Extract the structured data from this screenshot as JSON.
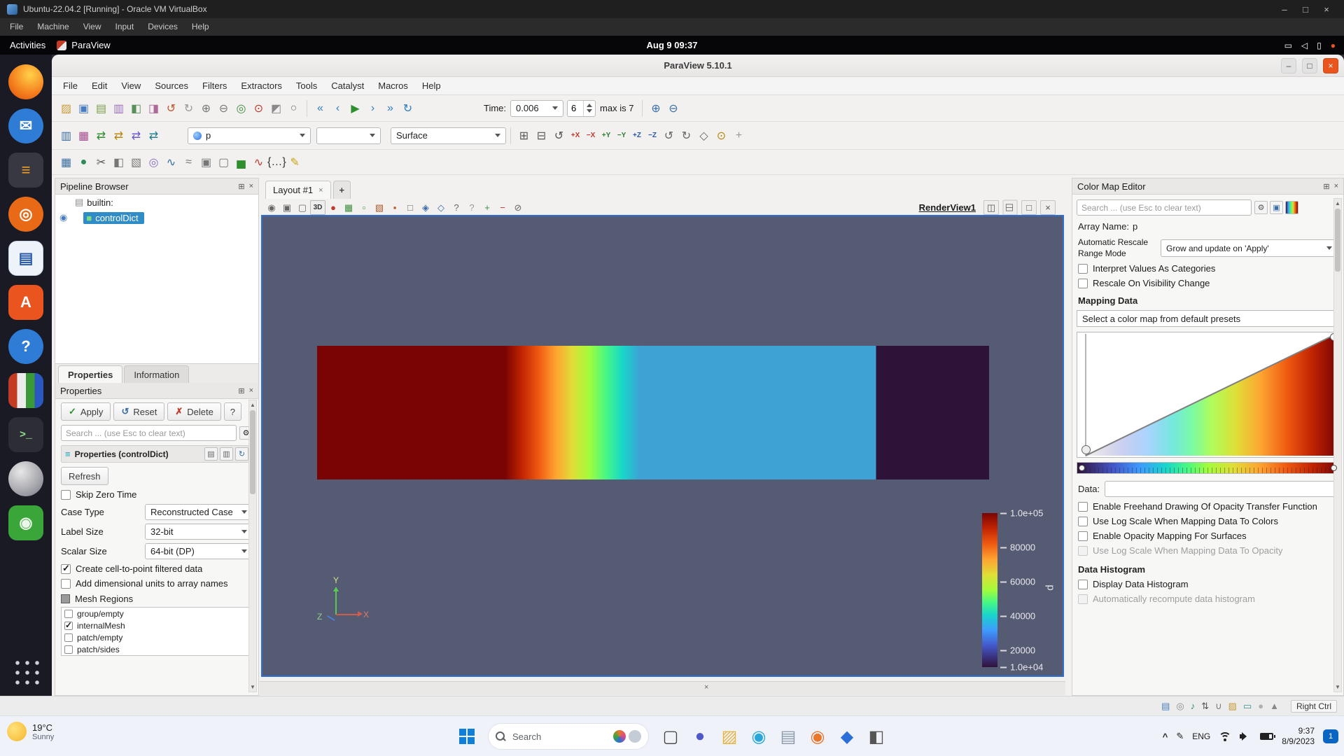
{
  "colors": {
    "selection": "#308cc6",
    "viewport_background": "#565b74",
    "accent_close": "#e9541f",
    "colormap_turbo": [
      "#30123b",
      "#4458cb",
      "#3e9bfe",
      "#18d6cb",
      "#46f884",
      "#a2fc3c",
      "#e1dd37",
      "#fea331",
      "#ef5a11",
      "#c22402",
      "#7a0403"
    ]
  },
  "vbox": {
    "title": "Ubuntu-22.04.2 [Running] - Oracle VM VirtualBox",
    "menu": [
      {
        "n": "vbox-menu-file",
        "label": "File"
      },
      {
        "n": "vbox-menu-machine",
        "label": "Machine"
      },
      {
        "n": "vbox-menu-view",
        "label": "View"
      },
      {
        "n": "vbox-menu-input",
        "label": "Input"
      },
      {
        "n": "vbox-menu-devices",
        "label": "Devices"
      },
      {
        "n": "vbox-menu-help",
        "label": "Help"
      }
    ],
    "window_buttons": {
      "min": "–",
      "max": "□",
      "close": "×"
    },
    "status_icons": [
      {
        "n": "hdd-status-icon",
        "g": "▤",
        "c": "#4a7dbf"
      },
      {
        "n": "optical-status-icon",
        "g": "◎",
        "c": "#8a8a8a"
      },
      {
        "n": "audio-status-icon",
        "g": "♪",
        "c": "#2e8b57"
      },
      {
        "n": "network-status-icon",
        "g": "⇅",
        "c": "#555555"
      },
      {
        "n": "usb-status-icon",
        "g": "∪",
        "c": "#777777"
      },
      {
        "n": "shared-folders-status-icon",
        "g": "▨",
        "c": "#c99c3a"
      },
      {
        "n": "display-status-icon",
        "g": "▭",
        "c": "#3f8f8f"
      },
      {
        "n": "recording-status-icon",
        "g": "●",
        "c": "#b0b0b0"
      },
      {
        "n": "mouse-status-icon",
        "g": "▲",
        "c": "#888888"
      }
    ],
    "host_key": "Right Ctrl"
  },
  "ubuntu": {
    "activities": "Activities",
    "app": "ParaView",
    "clock": "Aug 9  09:37",
    "tray": [
      {
        "n": "screencast-icon",
        "g": "▭",
        "c": "#ffffff"
      },
      {
        "n": "volume-tray-icon",
        "g": "◁",
        "c": "#ffffff"
      },
      {
        "n": "battery-tray-icon",
        "g": "▯",
        "c": "#ffffff"
      },
      {
        "n": "notification-dot-icon",
        "g": "●",
        "c": "#e95420"
      }
    ]
  },
  "dock": {
    "items": [
      {
        "n": "firefox-dock-icon",
        "g": "",
        "bg": "radial-gradient(circle at 62% 30%, #ffd24a, #f5821f 55%, #e3560f 90%)",
        "cls": "round"
      },
      {
        "n": "thunderbird-dock-icon",
        "g": "✉",
        "c": "#ffffff",
        "bg": "#2e7cd6",
        "cls": "round"
      },
      {
        "n": "text-editor-dock-icon",
        "g": "≡",
        "c": "#f0a02a",
        "bg": "#383842"
      },
      {
        "n": "rhythmbox-dock-icon",
        "g": "◎",
        "c": "#ffffff",
        "bg": "#e86a17",
        "cls": "round"
      },
      {
        "n": "libreoffice-writer-dock-icon",
        "g": "▤",
        "c": "#2a5caa",
        "bg": "#eef3fa",
        "cls": "brd"
      },
      {
        "n": "ubuntu-software-dock-icon",
        "g": "A",
        "c": "#ffffff",
        "bg": "#e9541f"
      },
      {
        "n": "help-dock-icon",
        "g": "?",
        "c": "#ffffff",
        "bg": "#2e7cd6",
        "cls": "round"
      },
      {
        "n": "paraview-dock-icon",
        "g": "",
        "bg": "linear-gradient(90deg,#c23b22 0 25%,#ececec 25% 50%,#3a9a3a 50% 75%,#2a58c0 75% 100%)"
      },
      {
        "n": "terminal-dock-icon",
        "g": ">_",
        "c": "#8fe08f",
        "bg": "#2d2d36",
        "cls": "mono"
      },
      {
        "n": "sphere-dock-icon",
        "g": "",
        "bg": "radial-gradient(circle at 35% 30%, #e8e8e8, #9a9aa2 70%, #6f6f78)",
        "cls": "round"
      },
      {
        "n": "game-dock-icon",
        "g": "◉",
        "c": "#eaf6ea",
        "bg": "#3aa63a"
      }
    ]
  },
  "paraview": {
    "title": "ParaView 5.10.1",
    "window_buttons": {
      "min": "–",
      "max": "□",
      "close": "×"
    },
    "panel_icons": {
      "float": "⊞",
      "close": "×"
    },
    "menu": [
      {
        "n": "menu-file",
        "label": "File"
      },
      {
        "n": "menu-edit",
        "label": "Edit"
      },
      {
        "n": "menu-view",
        "label": "View"
      },
      {
        "n": "menu-sources",
        "label": "Sources"
      },
      {
        "n": "menu-filters",
        "label": "Filters"
      },
      {
        "n": "menu-extractors",
        "label": "Extractors"
      },
      {
        "n": "menu-tools",
        "label": "Tools"
      },
      {
        "n": "menu-catalyst",
        "label": "Catalyst"
      },
      {
        "n": "menu-macros",
        "label": "Macros"
      },
      {
        "n": "menu-help",
        "label": "Help"
      }
    ],
    "toolbar_main": {
      "icons_left": [
        {
          "n": "open-file-icon",
          "g": "▨",
          "c": "#c99c3a"
        },
        {
          "n": "save-data-icon",
          "g": "▣",
          "c": "#4a7dbf"
        },
        {
          "n": "load-state-icon",
          "g": "▤",
          "c": "#7c9c4a"
        },
        {
          "n": "save-state-icon",
          "g": "▥",
          "c": "#9a6fbf"
        },
        {
          "n": "save-screenshot-icon",
          "g": "◧",
          "c": "#5a8f5a"
        },
        {
          "n": "save-animation-icon",
          "g": "◨",
          "c": "#b06a9a"
        },
        {
          "n": "undo-icon",
          "g": "↺",
          "c": "#c4542a"
        },
        {
          "n": "redo-icon",
          "g": "↻",
          "c": "#9a9a9a"
        },
        {
          "n": "connect-icon",
          "g": "⊕",
          "c": "#777777"
        },
        {
          "n": "disconnect-icon",
          "g": "⊖",
          "c": "#777777"
        },
        {
          "n": "auto-apply-icon",
          "g": "◎",
          "c": "#3f8f3f"
        },
        {
          "n": "reset-session-icon",
          "g": "⊙",
          "c": "#c0392b"
        },
        {
          "n": "load-palette-icon",
          "g": "◩",
          "c": "#8a8a8a"
        },
        {
          "n": "search-data-icon",
          "g": "○",
          "c": "#777777"
        }
      ],
      "playback": [
        {
          "n": "first-frame-icon",
          "g": "«",
          "c": "#2e7dbf"
        },
        {
          "n": "previous-frame-icon",
          "g": "‹",
          "c": "#2e7dbf"
        },
        {
          "n": "play-icon",
          "g": "▶",
          "c": "#2f8f2f"
        },
        {
          "n": "next-frame-icon",
          "g": "›",
          "c": "#2e7dbf"
        },
        {
          "n": "last-frame-icon",
          "g": "»",
          "c": "#2e7dbf"
        },
        {
          "n": "loop-icon",
          "g": "↻",
          "c": "#2e7dbf"
        }
      ],
      "time_label": "Time:",
      "time_value": "0.006",
      "frame_value": "6",
      "max_label": "max is 7",
      "icons_right": [
        {
          "n": "zoom-box-icon",
          "g": "⊕",
          "c": "#3a6ea5"
        },
        {
          "n": "zoom-data-icon",
          "g": "⊖",
          "c": "#3a6ea5"
        }
      ]
    },
    "toolbar_props": {
      "icons_left": [
        {
          "n": "toggle-color-legend-icon",
          "g": "▥",
          "c": "#3a6ea5"
        },
        {
          "n": "edit-color-map-icon",
          "g": "▦",
          "c": "#a84a8f"
        },
        {
          "n": "rescale-to-data-icon",
          "g": "⇄",
          "c": "#2f8f2f"
        },
        {
          "n": "rescale-custom-icon",
          "g": "⇄",
          "c": "#b8860b"
        },
        {
          "n": "rescale-temporal-icon",
          "g": "⇄",
          "c": "#6a5acd"
        },
        {
          "n": "rescale-visible-icon",
          "g": "⇄",
          "c": "#20808f"
        }
      ],
      "array_value": "p",
      "component_value": "",
      "representation_value": "Surface",
      "icons_right": [
        {
          "n": "zoom-to-box-icon",
          "g": "⊞",
          "c": "#555555"
        },
        {
          "n": "zoom-to-data-icon",
          "g": "⊟",
          "c": "#555555"
        },
        {
          "n": "reset-camera-icon",
          "g": "↺",
          "c": "#555555"
        },
        {
          "n": "view-plus-x-icon",
          "g": "+X",
          "c": "#c0392b",
          "cls": "axis"
        },
        {
          "n": "view-minus-x-icon",
          "g": "−X",
          "c": "#c0392b",
          "cls": "axis"
        },
        {
          "n": "view-plus-y-icon",
          "g": "+Y",
          "c": "#2e7d32",
          "cls": "axis"
        },
        {
          "n": "view-minus-y-icon",
          "g": "−Y",
          "c": "#2e7d32",
          "cls": "axis"
        },
        {
          "n": "view-plus-z-icon",
          "g": "+Z",
          "c": "#2857a4",
          "cls": "axis"
        },
        {
          "n": "view-minus-z-icon",
          "g": "−Z",
          "c": "#2857a4",
          "cls": "axis"
        },
        {
          "n": "rotate-ccw-icon",
          "g": "↺",
          "c": "#666666"
        },
        {
          "n": "rotate-cw-icon",
          "g": "↻",
          "c": "#666666"
        },
        {
          "n": "isometric-view-icon",
          "g": "◇",
          "c": "#666666"
        },
        {
          "n": "center-of-rotation-icon",
          "g": "⊙",
          "c": "#b8860b"
        },
        {
          "n": "orientation-axes-icon",
          "g": "+",
          "c": "#999999"
        }
      ]
    },
    "toolbar_filters": {
      "icons": [
        {
          "n": "spreadsheet-view-icon",
          "g": "▦",
          "c": "#3a6ea5"
        },
        {
          "n": "glyph-filter-icon",
          "g": "●",
          "c": "#2e8b57"
        },
        {
          "n": "clip-filter-icon",
          "g": "✂",
          "c": "#555555"
        },
        {
          "n": "slice-filter-icon",
          "g": "◧",
          "c": "#777777"
        },
        {
          "n": "threshold-filter-icon",
          "g": "▧",
          "c": "#777777"
        },
        {
          "n": "contour-filter-icon",
          "g": "◎",
          "c": "#8a6fbf"
        },
        {
          "n": "stream-tracer-icon",
          "g": "∿",
          "c": "#2e6da4"
        },
        {
          "n": "warp-filter-icon",
          "g": "≈",
          "c": "#777777"
        },
        {
          "n": "group-datasets-icon",
          "g": "▣",
          "c": "#777777"
        },
        {
          "n": "extract-block-icon",
          "g": "▢",
          "c": "#777777"
        },
        {
          "n": "histogram-icon",
          "g": "▅",
          "c": "#2f8f2f"
        },
        {
          "n": "plot-over-line-icon",
          "g": "∿",
          "c": "#c0392b"
        },
        {
          "n": "python-shell-icon",
          "g": "{…}",
          "c": "#333333"
        },
        {
          "n": "measure-icon",
          "g": "✎",
          "c": "#c8a415"
        }
      ]
    },
    "pipeline": {
      "title": "Pipeline Browser",
      "eye": "◉",
      "items": [
        {
          "n": "pipeline-item-builtin",
          "g": "▤",
          "label": "builtin:"
        },
        {
          "n": "pipeline-item-controldict",
          "g": "■",
          "label": "controlDict",
          "selected": true
        }
      ]
    },
    "panel_tabs": [
      {
        "n": "tab-properties",
        "label": "Properties",
        "active": true
      },
      {
        "n": "tab-information",
        "label": "Information"
      }
    ],
    "properties": {
      "section_title": "Properties",
      "apply_label": "Apply",
      "apply_icon": "✓",
      "reset_label": "Reset",
      "reset_icon": "↺",
      "delete_label": "Delete",
      "delete_icon": "✗",
      "help_label": "?",
      "search_placeholder": "Search ... (use Esc to clear text)",
      "search_gear": "⚙",
      "group_icon": "≡",
      "group_title": "Properties (controlDict)",
      "group_buttons": [
        {
          "n": "copy-properties-icon",
          "g": "▤",
          "c": "#666666"
        },
        {
          "n": "paste-properties-icon",
          "g": "▥",
          "c": "#666666"
        },
        {
          "n": "restore-defaults-icon",
          "g": "↻",
          "c": "#3a6ea5"
        }
      ],
      "refresh_label": "Refresh",
      "skip_zero_time": "Skip Zero Time",
      "case_type_label": "Case Type",
      "case_type_value": "Reconstructed Case",
      "label_size_label": "Label Size",
      "label_size_value": "32-bit",
      "scalar_size_label": "Scalar Size",
      "scalar_size_value": "64-bit (DP)",
      "cb_cell_to_point": "Create cell-to-point filtered data",
      "cb_dimensional": "Add dimensional units to array names",
      "mesh_regions_label": "Mesh Regions",
      "mesh_regions": [
        {
          "n": "mesh-region-group-empty",
          "label": "group/empty"
        },
        {
          "n": "mesh-region-internalmesh",
          "label": "internalMesh",
          "checked": true
        },
        {
          "n": "mesh-region-patch-empty",
          "label": "patch/empty"
        },
        {
          "n": "mesh-region-patch-sides",
          "label": "patch/sides"
        }
      ]
    },
    "layout": {
      "tab": "Layout #1",
      "add_tab": "+",
      "view_name": "RenderView1"
    },
    "viewbar_icons": [
      {
        "n": "camera-icon",
        "g": "◉",
        "c": "#666666"
      },
      {
        "n": "save-view-icon",
        "g": "▣",
        "c": "#666666"
      },
      {
        "n": "copy-view-icon",
        "g": "▢",
        "c": "#666666"
      },
      {
        "n": "toggle-3d-icon",
        "g": "3D",
        "c": "#333333",
        "cls": "chip"
      },
      {
        "n": "record-icon",
        "g": "●",
        "c": "#c0392b"
      },
      {
        "n": "select-surface-cells-icon",
        "g": "▦",
        "c": "#3f8f3f"
      },
      {
        "n": "select-surface-points-icon",
        "g": "▫",
        "c": "#3f8f3f"
      },
      {
        "n": "select-frustum-cells-icon",
        "g": "▧",
        "c": "#b05a2a"
      },
      {
        "n": "select-frustum-points-icon",
        "g": "▪",
        "c": "#b05a2a"
      },
      {
        "n": "select-block-icon",
        "g": "□",
        "c": "#666666"
      },
      {
        "n": "interactive-select-cells-icon",
        "g": "◈",
        "c": "#3a6ea5"
      },
      {
        "n": "interactive-select-points-icon",
        "g": "◇",
        "c": "#3a6ea5"
      },
      {
        "n": "hover-cells-icon",
        "g": "?",
        "c": "#666666"
      },
      {
        "n": "hover-points-icon",
        "g": "?",
        "c": "#999999"
      },
      {
        "n": "grow-selection-icon",
        "g": "+",
        "c": "#3f8f3f"
      },
      {
        "n": "shrink-selection-icon",
        "g": "−",
        "c": "#c0392b"
      },
      {
        "n": "clear-selection-icon",
        "g": "⊘",
        "c": "#666666"
      }
    ],
    "view_controls": [
      {
        "n": "split-horizontal-icon",
        "g": "◫"
      },
      {
        "n": "split-vertical-icon",
        "g": "◫",
        "cls": "rot90"
      },
      {
        "n": "maximize-view-icon",
        "g": "□"
      },
      {
        "n": "close-view-icon",
        "g": "×"
      }
    ],
    "viewport": {
      "legend": {
        "title": "p",
        "ticks": [
          "1.0e+05",
          "80000",
          "60000",
          "40000",
          "20000",
          "1.0e+04"
        ]
      },
      "axes": {
        "x": "X",
        "y": "Y",
        "z": "Z"
      }
    },
    "colormap": {
      "title": "Color Map Editor",
      "search_placeholder": "Search ... (use Esc to clear text)",
      "search_buttons": [
        {
          "n": "settings-gear-icon",
          "g": "⚙",
          "c": "#555555"
        },
        {
          "n": "indexed-lookup-icon",
          "g": "▣",
          "c": "#3a6ea5"
        },
        {
          "n": "choose-preset-icon",
          "g": "",
          "bg": "linear-gradient(90deg,#30123b,#3e9bfe,#46f884,#e1dd37,#ef5a11,#7a0403)"
        }
      ],
      "array_label": "Array Name:",
      "array_value": "p",
      "rescale_label_1": "Automatic Rescale",
      "rescale_label_2": "Range Mode",
      "rescale_value": "Grow and update on 'Apply'",
      "checkboxes_top": [
        {
          "n": "checkbox-interpret-categories",
          "label": "Interpret Values As Categories"
        },
        {
          "n": "checkbox-rescale-visibility",
          "label": "Rescale On Visibility Change"
        }
      ],
      "mapping_title": "Mapping Data",
      "preset_hint": "Select a color map from default presets",
      "data_label": "Data:",
      "checkboxes_mid": [
        {
          "n": "checkbox-freehand-opacity",
          "label": "Enable Freehand Drawing Of Opacity Transfer Function"
        },
        {
          "n": "checkbox-log-scale-colors",
          "label": "Use Log Scale When Mapping Data To Colors"
        },
        {
          "n": "checkbox-opacity-surfaces",
          "label": "Enable Opacity Mapping For Surfaces"
        },
        {
          "n": "checkbox-log-scale-opacity",
          "label": "Use Log Scale When Mapping Data To Opacity",
          "disabled": true
        }
      ],
      "histogram_title": "Data Histogram",
      "checkboxes_hist": [
        {
          "n": "checkbox-display-histogram",
          "label": "Display Data Histogram"
        },
        {
          "n": "checkbox-auto-recompute-histogram",
          "label": "Automatically recompute data histogram",
          "disabled": true
        }
      ]
    }
  },
  "taskbar": {
    "weather_temp": "19°C",
    "weather_cond": "Sunny",
    "search_label": "Search",
    "apps": [
      {
        "n": "taskview-icon",
        "g": "▢",
        "c": "#444444"
      },
      {
        "n": "teams-chat-icon",
        "g": "●",
        "c": "#5059c9"
      },
      {
        "n": "file-explorer-icon",
        "g": "▨",
        "c": "#e8b33d"
      },
      {
        "n": "edge-icon",
        "g": "◉",
        "c": "#2aa7d8"
      },
      {
        "n": "store-icon",
        "g": "▤",
        "c": "#8a98a8"
      },
      {
        "n": "firefox-taskbar-icon",
        "g": "◉",
        "c": "#e8762d"
      },
      {
        "n": "defender-icon",
        "g": "◆",
        "c": "#2a6fd8"
      },
      {
        "n": "photos-icon",
        "g": "◧",
        "c": "#555555"
      }
    ],
    "tray_chevron": "^",
    "tray_pen": "✎",
    "tray_lang": "ENG",
    "tray_time": "9:37",
    "tray_date": "8/9/2023",
    "badge": "1"
  }
}
